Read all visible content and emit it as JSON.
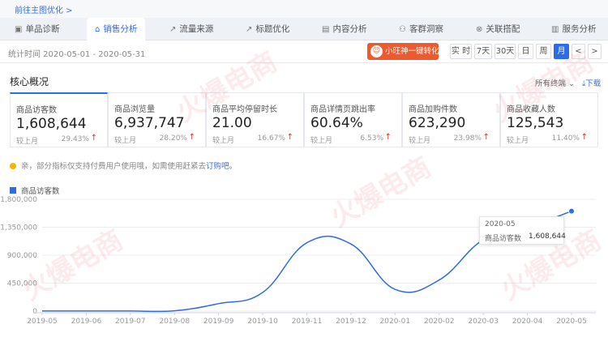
{
  "breadcrumb": "前往主图优化 >",
  "tabs": [
    {
      "label": "单品诊断",
      "icon": "clipboard-icon"
    },
    {
      "label": "销售分析",
      "icon": "home-icon"
    },
    {
      "label": "流量来源",
      "icon": "trend-icon"
    },
    {
      "label": "标题优化",
      "icon": "chart-line-icon"
    },
    {
      "label": "内容分析",
      "icon": "document-icon"
    },
    {
      "label": "客群洞察",
      "icon": "users-icon"
    },
    {
      "label": "关联搭配",
      "icon": "link-icon"
    },
    {
      "label": "服务分析",
      "icon": "chart-bar-icon"
    }
  ],
  "period": "统计时间 2020-05-01 - 2020-05-31",
  "promo": {
    "label": "小旺神一键转化"
  },
  "time_buttons": [
    "实 时",
    "7天",
    "30天",
    "日",
    "周",
    "月"
  ],
  "time_nav": {
    "prev": "<",
    "next": ">"
  },
  "section": {
    "title": "核心概况",
    "terminal": "所有终端",
    "download": "下载"
  },
  "metrics": [
    {
      "label": "商品访客数",
      "value": "1,608,644",
      "compare": "较上月",
      "pct": "29.43%"
    },
    {
      "label": "商品浏览量",
      "value": "6,937,747",
      "compare": "较上月",
      "pct": "28.20%"
    },
    {
      "label": "商品平均停留时长",
      "value": "21.00",
      "compare": "较上月",
      "pct": "16.67%"
    },
    {
      "label": "商品详情页跳出率",
      "value": "60.64%",
      "compare": "较上月",
      "pct": "6.53%"
    },
    {
      "label": "商品加购件数",
      "value": "623,290",
      "compare": "较上月",
      "pct": "23.98%"
    },
    {
      "label": "商品收藏人数",
      "value": "125,543",
      "compare": "较上月",
      "pct": "11.40%"
    }
  ],
  "notice": {
    "text": "亲，部分指标仅支持付费用户使用哦，如需使用赶紧去",
    "link": "订购吧。"
  },
  "tooltip": {
    "date": "2020-05",
    "name": "商品访客数",
    "value": "1,608,644"
  },
  "watermark": "火爆电商",
  "colors": {
    "accent": "#2e6be6",
    "promo": "#ee5a2e",
    "up": "#e0301e"
  },
  "chart_data": {
    "type": "line",
    "legend": "商品访客数",
    "categories": [
      "2019-05",
      "2019-06",
      "2019-07",
      "2019-08",
      "2019-09",
      "2019-10",
      "2019-11",
      "2019-12",
      "2020-01",
      "2020-02",
      "2020-03",
      "2020-04",
      "2020-05"
    ],
    "series": [
      {
        "name": "商品访客数",
        "values": [
          2000,
          2000,
          2000,
          5000,
          120000,
          300000,
          1100000,
          1080000,
          350000,
          500000,
          1150000,
          1350000,
          1608644
        ]
      }
    ],
    "yticks": [
      0,
      450000,
      900000,
      1350000,
      1800000
    ],
    "ytick_labels": [
      "0",
      "450,000",
      "900,000",
      "1,350,000",
      "1,800,000"
    ],
    "ylim": [
      0,
      1800000
    ],
    "grid": true
  }
}
